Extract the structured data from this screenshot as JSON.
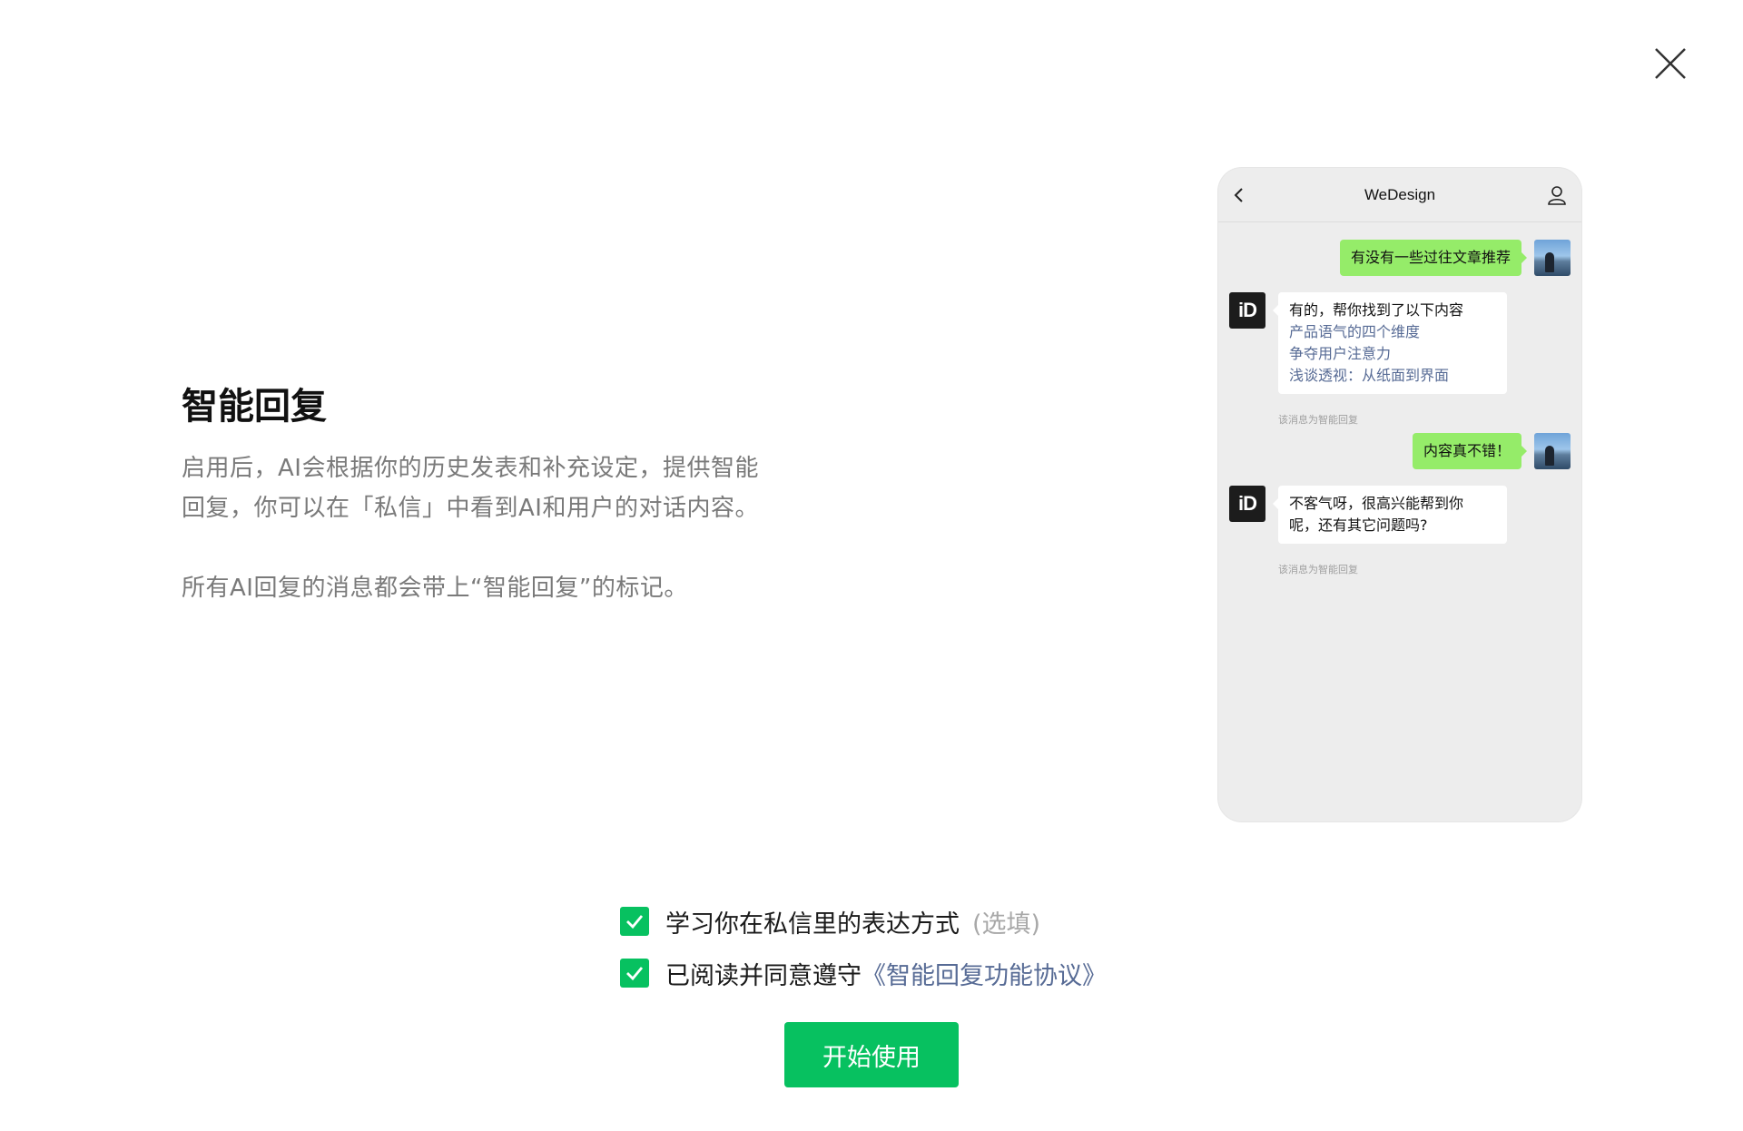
{
  "dialog": {
    "close_icon": "close-icon"
  },
  "intro": {
    "title": "智能回复",
    "description_line1": "启用后，AI会根据你的历史发表和补充设定，提供智能",
    "description_line2": "回复，你可以在「私信」中看到AI和用户的对话内容。",
    "note": "所有AI回复的消息都会带上“智能回复”的标记。"
  },
  "preview": {
    "title": "WeDesign",
    "back_icon": "chevron-left-icon",
    "profile_icon": "person-icon",
    "bot_avatar_text": "iD",
    "messages": [
      {
        "from": "user",
        "text": "有没有一些过往文章推荐"
      },
      {
        "from": "bot",
        "text": "有的，帮你找到了以下内容",
        "links": [
          "产品语气的四个维度",
          "争夺用户注意力",
          "浅谈透视：从纸面到界面"
        ],
        "tag": "该消息为智能回复"
      },
      {
        "from": "user",
        "text": "内容真不错！"
      },
      {
        "from": "bot",
        "text_line1": "不客气呀，很高兴能帮到你",
        "text_line2": "呢，还有其它问题吗?",
        "tag": "该消息为智能回复"
      }
    ]
  },
  "options": {
    "learn_style": {
      "label": "学习你在私信里的表达方式",
      "optional": "(选填)",
      "checked": true
    },
    "agreement": {
      "label": "已阅读并同意遵守",
      "link": "《智能回复功能协议》",
      "checked": true
    }
  },
  "actions": {
    "start_label": "开始使用"
  },
  "colors": {
    "primary": "#07c160",
    "link": "#576b95",
    "user_bubble": "#95ec69",
    "chat_bg": "#ededed"
  }
}
